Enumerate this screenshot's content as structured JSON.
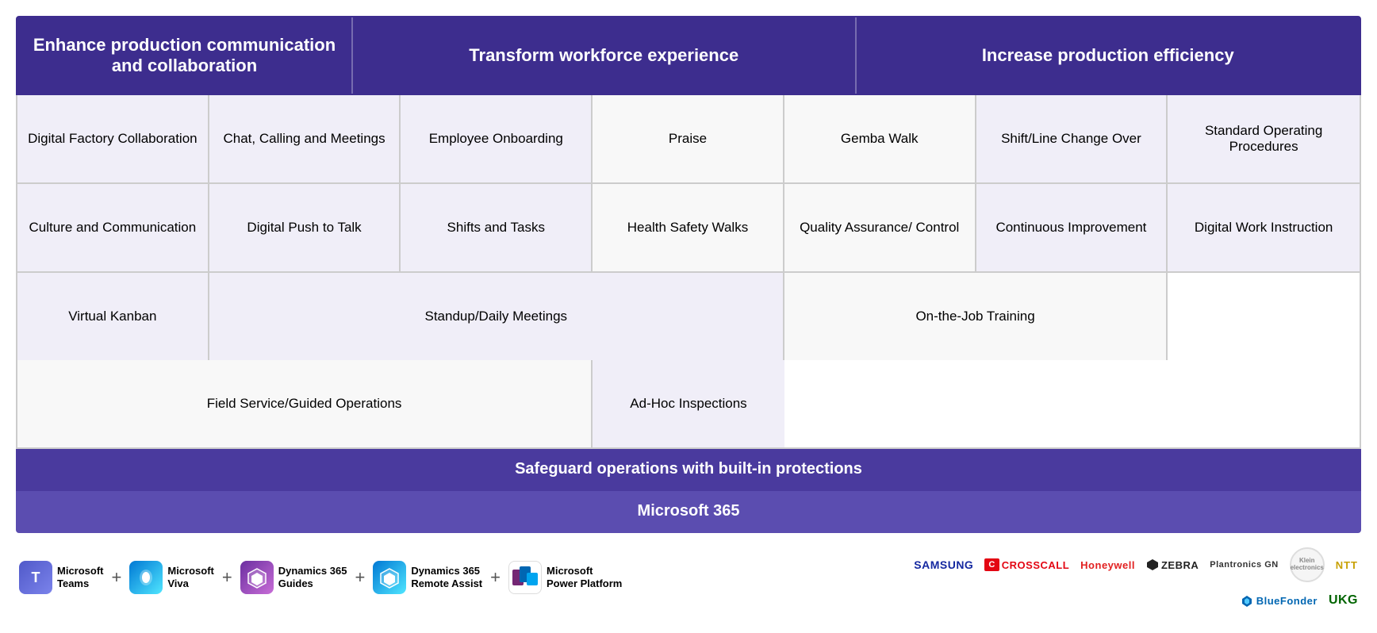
{
  "header": {
    "col1": "Enhance production communication and collaboration",
    "col2": "Transform workforce experience",
    "col3": "Increase production efficiency"
  },
  "rows": [
    {
      "cells": [
        {
          "text": "Digital Factory Collaboration",
          "class": "col-enhance"
        },
        {
          "text": "Chat, Calling and Meetings",
          "class": "col-enhance"
        },
        {
          "text": "Employee Onboarding",
          "class": "col-enhance"
        },
        {
          "text": "Praise",
          "class": "col-transform"
        },
        {
          "text": "Gemba Walk",
          "class": "col-transform"
        },
        {
          "text": "Shift/Line Change Over",
          "class": "col-increase"
        },
        {
          "text": "Standard Operating Procedures",
          "class": "col-increase"
        }
      ]
    },
    {
      "cells": [
        {
          "text": "Culture and Communication",
          "class": "col-enhance"
        },
        {
          "text": "Digital Push to Talk",
          "class": "col-enhance"
        },
        {
          "text": "Shifts and Tasks",
          "class": "col-enhance"
        },
        {
          "text": "Health Safety Walks",
          "class": "col-transform"
        },
        {
          "text": "Quality Assurance/ Control",
          "class": "col-transform"
        },
        {
          "text": "Continuous Improvement",
          "class": "col-increase"
        },
        {
          "text": "Digital Work Instruction",
          "class": "col-increase"
        }
      ]
    },
    {
      "cells_special": [
        {
          "text": "Virtual Kanban",
          "class": "col-enhance",
          "span": 1
        },
        {
          "text": "Standup/Daily Meetings",
          "class": "col-enhance",
          "span": 2
        },
        {
          "text": "On-the-Job Training",
          "class": "col-transform",
          "span": 1
        },
        {
          "text": "Field Service/Guided Operations",
          "class": "col-transform",
          "span": 2
        },
        {
          "text": "Ad-Hoc Inspections",
          "class": "col-increase",
          "span": 1
        }
      ]
    }
  ],
  "banners": {
    "safeguard": "Safeguard operations with built-in protections",
    "m365": "Microsoft 365"
  },
  "footer": {
    "products": [
      {
        "name_line1": "Microsoft",
        "name_line2": "Teams"
      },
      {
        "name_line1": "Microsoft",
        "name_line2": "Viva"
      },
      {
        "name_line1": "Dynamics 365",
        "name_line2": "Guides"
      },
      {
        "name_line1": "Dynamics 365",
        "name_line2": "Remote Assist"
      },
      {
        "name_line1": "Microsoft",
        "name_line2": "Power Platform"
      }
    ],
    "partners": [
      "SAMSUNG",
      "CROSSCALL",
      "Honeywell",
      "ZEBRA",
      "Plantronics GN",
      "Klein electronics",
      "NTT",
      "BlueFonder",
      "UKG"
    ]
  }
}
